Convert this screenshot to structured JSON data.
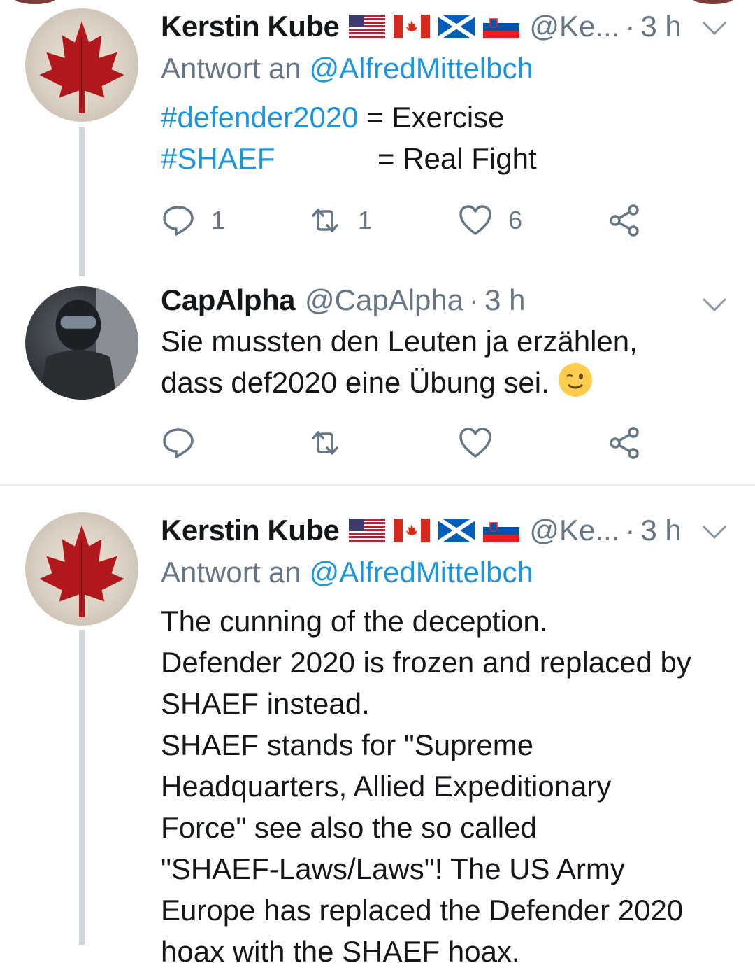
{
  "tweets": [
    {
      "name": "Kerstin Kube",
      "handle": "@Ke...",
      "dot": "·",
      "time": "3 h",
      "reply_prefix": "Antwort an",
      "reply_mention": "@AlfredMittelbch",
      "lines": [
        {
          "tag": "#defender2020",
          "text": " = Exercise"
        },
        {
          "tag": "#SHAEF",
          "text": "= Real Fight"
        }
      ],
      "replies": "1",
      "retweets": "1",
      "likes": "6"
    },
    {
      "name": "CapAlpha",
      "handle": "@CapAlpha",
      "dot": "·",
      "time": "3 h",
      "text_line1": "Sie mussten den Leuten ja erzählen,",
      "text_line2": "dass def2020 eine Übung sei.",
      "emoji": "winking-face"
    },
    {
      "name": "Kerstin Kube",
      "handle": "@Ke...",
      "dot": "·",
      "time": "3 h",
      "reply_prefix": "Antwort an",
      "reply_mention": "@AlfredMittelbch",
      "lines": [
        "The cunning of the deception.",
        "Defender 2020 is frozen and replaced by",
        "SHAEF instead.",
        "SHAEF stands for \"Supreme",
        "Headquarters, Allied Expeditionary",
        "Force\" see also the so called",
        "\"SHAEF-Laws/Laws\"! The US Army",
        "Europe has replaced the Defender 2020",
        "hoax with the SHAEF hoax."
      ]
    }
  ],
  "colors": {
    "link": "#1b95e0",
    "secondary": "#657786",
    "text": "#14171a",
    "thread_line": "#ccd6dd",
    "divider": "#e6ecf0"
  },
  "icons": {
    "reply": "reply-icon",
    "retweet": "retweet-icon",
    "like": "heart-icon",
    "share": "share-icon",
    "more": "chevron-down-icon",
    "flags": [
      "us-flag-icon",
      "canada-flag-icon",
      "scotland-flag-icon",
      "slovenia-flag-icon"
    ]
  }
}
